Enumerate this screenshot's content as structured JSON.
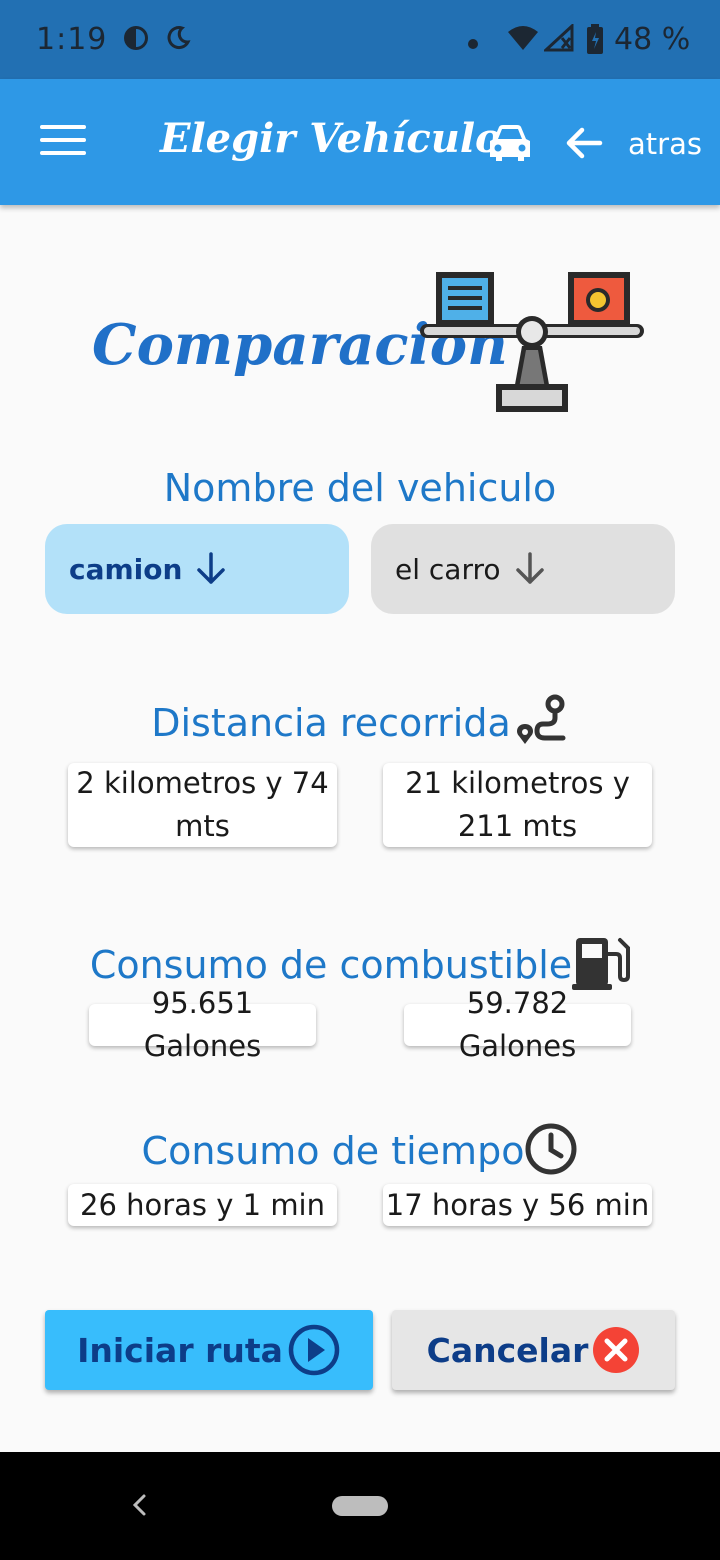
{
  "status_bar": {
    "time": "1:19",
    "battery": "48 %",
    "icons": [
      "pie-timer-icon",
      "night-mode-icon",
      "dot-icon",
      "wifi-icon",
      "signal-icon",
      "battery-icon"
    ]
  },
  "app_bar": {
    "title": "Elegir Vehículo",
    "back_label": "atras",
    "icons": [
      "menu-icon",
      "car-icon",
      "arrow-back-icon"
    ],
    "color": "#2e98e6"
  },
  "header": {
    "title": "Comparación",
    "icon": "balance-scale-icon"
  },
  "vehicle_section": {
    "label": "Nombre del vehiculo",
    "vehicle_a": "camion",
    "vehicle_b": "el carro"
  },
  "distance": {
    "label": "Distancia recorrida",
    "icon": "route-icon",
    "value_a": "2 kilometros y 74 mts",
    "value_b": "21 kilometros y 211 mts"
  },
  "fuel": {
    "label": "Consumo de combustible",
    "icon": "fuel-pump-icon",
    "value_a": "95.651 Galones",
    "value_b": "59.782 Galones"
  },
  "time": {
    "label": "Consumo de tiempo",
    "icon": "clock-icon",
    "value_a": "26 horas y 1 min",
    "value_b": "17 horas y 56 min"
  },
  "actions": {
    "start_label": "Iniciar ruta",
    "cancel_label": "Cancelar",
    "start_color": "#38bdfc",
    "cancel_icon_color": "#f44336"
  }
}
